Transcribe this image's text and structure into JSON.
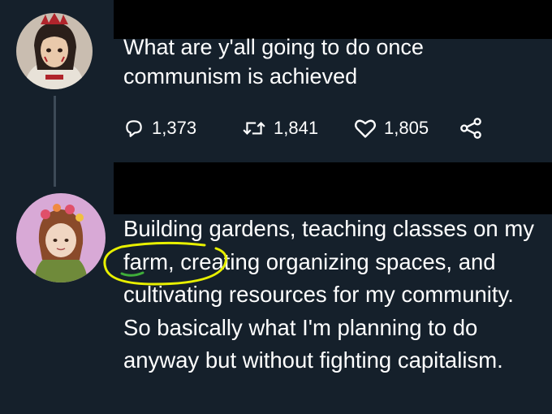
{
  "tweet1": {
    "text": "What are y'all going to do once communism is achieved",
    "avatar_icon": "anime-character-avatar-icon",
    "stats": {
      "replies": "1,373",
      "retweets": "1,841",
      "likes": "1,805"
    },
    "icons": {
      "reply": "reply-icon",
      "retweet": "retweet-icon",
      "like": "heart-icon",
      "share": "share-icon"
    }
  },
  "tweet2": {
    "text": "Building gardens, teaching classes on my farm, creating organizing spaces, and cultivating resources for my community. So basically what I'm planning to do anyway but without fighting capitalism.",
    "avatar_icon": "illustrated-person-avatar-icon"
  },
  "colors": {
    "background": "#15202b",
    "text": "#ffffff",
    "redaction": "#000000",
    "annotation": "#e8f000",
    "thread_line": "#3d4a57"
  }
}
